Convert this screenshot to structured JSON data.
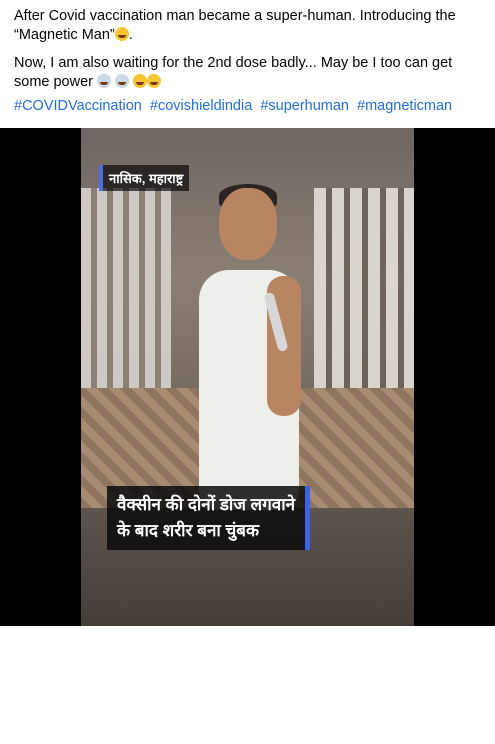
{
  "post": {
    "caption_line1": "After Covid vaccination man became a super-human. Introducing the “Magnetic Man”",
    "caption_line2": "Now, I am also waiting for the 2nd dose badly... May be I too can get some power",
    "hashtags": [
      "#COVIDVaccination",
      "#covishieldindia",
      "#superhuman",
      "#magneticman"
    ]
  },
  "video": {
    "location_tag": "नासिक, महाराष्ट्र",
    "overlay_line1": "वैक्सीन की दोनों डोज लगवाने",
    "overlay_line2": "के बाद शरीर बना चुंबक",
    "mute_icon": "speaker-muted-icon"
  }
}
